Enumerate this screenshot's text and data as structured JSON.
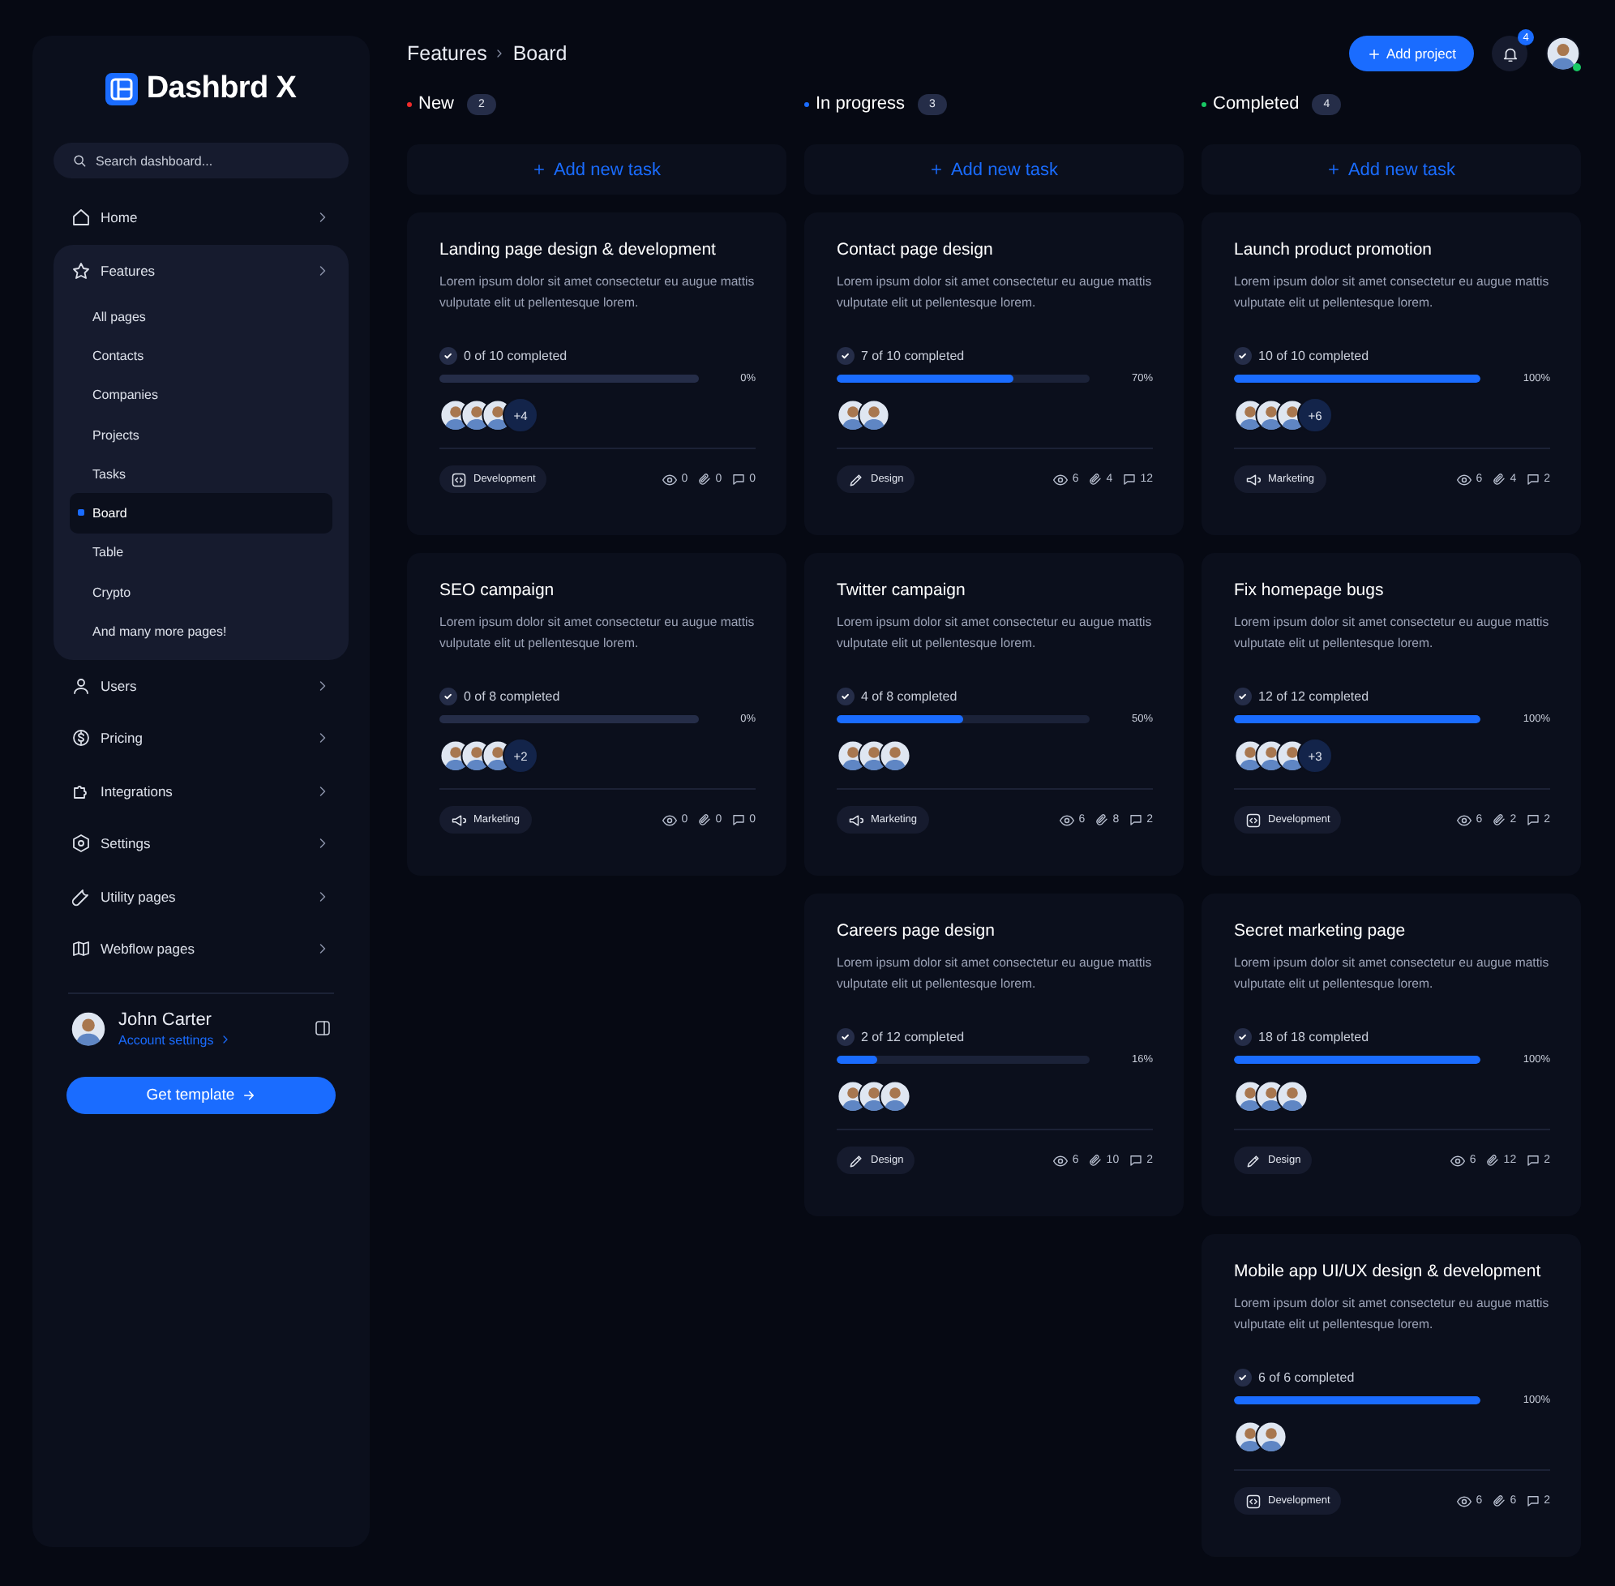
{
  "sidebar": {
    "brand": "Dashbrd X",
    "search": {
      "placeholder": "Search dashboard..."
    },
    "nav": [
      {
        "label": "Home",
        "kind": "home",
        "expanded": false
      },
      {
        "label": "Features",
        "kind": "star",
        "expanded": true,
        "children": [
          {
            "label": "All pages",
            "selected": false
          },
          {
            "label": "Contacts",
            "selected": false
          },
          {
            "label": "Companies",
            "selected": false
          },
          {
            "label": "Projects",
            "selected": false
          },
          {
            "label": "Tasks",
            "selected": false
          },
          {
            "label": "Board",
            "selected": true
          },
          {
            "label": "Table",
            "selected": false
          },
          {
            "label": "Crypto",
            "selected": false
          },
          {
            "label": "And many more pages!",
            "selected": false
          }
        ]
      },
      {
        "label": "Users",
        "kind": "user",
        "expanded": false
      },
      {
        "label": "Pricing",
        "kind": "dollar",
        "expanded": false
      },
      {
        "label": "Integrations",
        "kind": "puzzle",
        "expanded": false
      },
      {
        "label": "Settings",
        "kind": "gear",
        "expanded": false
      },
      {
        "label": "Utility pages",
        "kind": "wrench",
        "expanded": false
      },
      {
        "label": "Webflow pages",
        "kind": "map",
        "expanded": false
      }
    ],
    "user": {
      "name": "John Carter",
      "link": "Account settings"
    },
    "cta": "Get template"
  },
  "header": {
    "breadcrumb": [
      "Features",
      "Board"
    ],
    "add_button": "Add project",
    "notifications": "4",
    "user_online": true
  },
  "columns": [
    {
      "title": "New",
      "count": "2",
      "color": "#ef2b2b",
      "add_label": "Add new task",
      "cards": [
        {
          "title": "Landing page design & development",
          "description": "Lorem ipsum dolor sit amet consectetur eu augue mattis vulputate elit ut pellentesque lorem.",
          "progress_label": "0 of 10 completed",
          "level": 0,
          "percent": "0%",
          "avatars": [
            {
              "kind": "person"
            },
            {
              "kind": "person"
            },
            {
              "kind": "person"
            }
          ],
          "more": "+4",
          "tag": {
            "label": "Development",
            "kind": "code"
          },
          "views": "0",
          "attachments": "0",
          "comments": "0"
        },
        {
          "title": "SEO campaign",
          "description": "Lorem ipsum dolor sit amet consectetur eu augue mattis vulputate elit ut pellentesque lorem.",
          "progress_label": "0 of 8 completed",
          "level": 0,
          "percent": "0%",
          "avatars": [
            {
              "kind": "person"
            },
            {
              "kind": "person"
            },
            {
              "kind": "person"
            }
          ],
          "more": "+2",
          "tag": {
            "label": "Marketing",
            "kind": "megaphone"
          },
          "views": "0",
          "attachments": "0",
          "comments": "0"
        }
      ]
    },
    {
      "title": "In progress",
      "count": "3",
      "color": "#1a6cff",
      "add_label": "Add new task",
      "cards": [
        {
          "title": "Contact page design",
          "description": "Lorem ipsum dolor sit amet consectetur eu augue mattis vulputate elit ut pellentesque lorem.",
          "progress_label": "7 of 10 completed",
          "level": 0.7,
          "percent": "70%",
          "avatars": [
            {
              "kind": "person"
            },
            {
              "kind": "person"
            }
          ],
          "tag": {
            "label": "Design",
            "kind": "pen"
          },
          "views": "6",
          "attachments": "4",
          "comments": "12"
        },
        {
          "title": "Twitter campaign",
          "description": "Lorem ipsum dolor sit amet consectetur eu augue mattis vulputate elit ut pellentesque lorem.",
          "progress_label": "4 of 8 completed",
          "level": 0.5,
          "percent": "50%",
          "avatars": [
            {
              "kind": "person"
            },
            {
              "kind": "person"
            },
            {
              "kind": "person"
            }
          ],
          "tag": {
            "label": "Marketing",
            "kind": "megaphone"
          },
          "views": "6",
          "attachments": "8",
          "comments": "2"
        },
        {
          "title": "Careers page design",
          "description": "Lorem ipsum dolor sit amet consectetur eu augue mattis vulputate elit ut pellentesque lorem.",
          "progress_label": "2 of 12 completed",
          "level": 0.16,
          "percent": "16%",
          "avatars": [
            {
              "kind": "person"
            },
            {
              "kind": "person"
            },
            {
              "kind": "person"
            }
          ],
          "tag": {
            "label": "Design",
            "kind": "pen"
          },
          "views": "6",
          "attachments": "10",
          "comments": "2"
        }
      ]
    },
    {
      "title": "Completed",
      "count": "4",
      "color": "#18c964",
      "add_label": "Add new task",
      "cards": [
        {
          "title": "Launch product promotion",
          "description": "Lorem ipsum dolor sit amet consectetur eu augue mattis vulputate elit ut pellentesque lorem.",
          "progress_label": "10 of 10 completed",
          "level": 1,
          "percent": "100%",
          "avatars": [
            {
              "kind": "person"
            },
            {
              "kind": "person"
            },
            {
              "kind": "person"
            }
          ],
          "more": "+6",
          "tag": {
            "label": "Marketing",
            "kind": "megaphone"
          },
          "views": "6",
          "attachments": "4",
          "comments": "2"
        },
        {
          "title": "Fix homepage bugs",
          "description": "Lorem ipsum dolor sit amet consectetur eu augue mattis vulputate elit ut pellentesque lorem.",
          "progress_label": "12 of 12 completed",
          "level": 1,
          "percent": "100%",
          "avatars": [
            {
              "kind": "person"
            },
            {
              "kind": "person"
            },
            {
              "kind": "person"
            }
          ],
          "more": "+3",
          "tag": {
            "label": "Development",
            "kind": "code"
          },
          "views": "6",
          "attachments": "2",
          "comments": "2"
        },
        {
          "title": "Secret marketing page",
          "description": "Lorem ipsum dolor sit amet consectetur eu augue mattis vulputate elit ut pellentesque lorem.",
          "progress_label": "18 of 18 completed",
          "level": 1,
          "percent": "100%",
          "avatars": [
            {
              "kind": "person"
            },
            {
              "kind": "person"
            },
            {
              "kind": "person"
            }
          ],
          "tag": {
            "label": "Design",
            "kind": "pen"
          },
          "views": "6",
          "attachments": "12",
          "comments": "2"
        },
        {
          "title": "Mobile app UI/UX design & development",
          "description": "Lorem ipsum dolor sit amet consectetur eu augue mattis vulputate elit ut pellentesque lorem.",
          "progress_label": "6 of 6 completed",
          "level": 1,
          "percent": "100%",
          "avatars": [
            {
              "kind": "person"
            },
            {
              "kind": "person"
            }
          ],
          "tag": {
            "label": "Development",
            "kind": "code"
          },
          "views": "6",
          "attachments": "6",
          "comments": "2"
        }
      ]
    }
  ]
}
